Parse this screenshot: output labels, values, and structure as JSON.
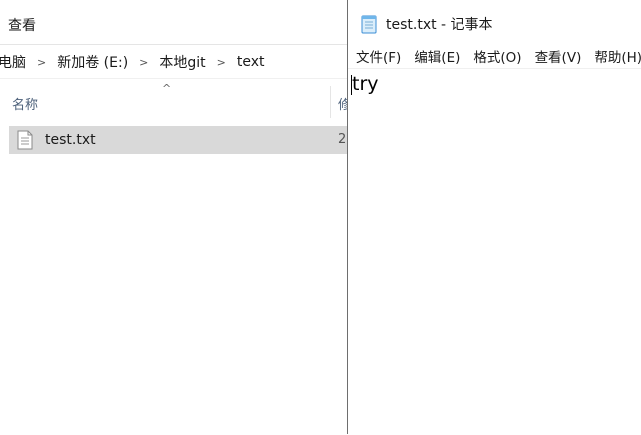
{
  "explorer": {
    "ribbon_tab": "查看",
    "breadcrumb": [
      "电脑",
      "新加卷 (E:)",
      "本地git",
      "text"
    ],
    "column_header": "名称",
    "column_header_2": "修",
    "files": [
      {
        "name": "test.txt",
        "extra": "2"
      }
    ]
  },
  "notepad": {
    "title": "test.txt - 记事本",
    "menu": [
      "文件(F)",
      "编辑(E)",
      "格式(O)",
      "查看(V)",
      "帮助(H)"
    ],
    "content": "try"
  }
}
